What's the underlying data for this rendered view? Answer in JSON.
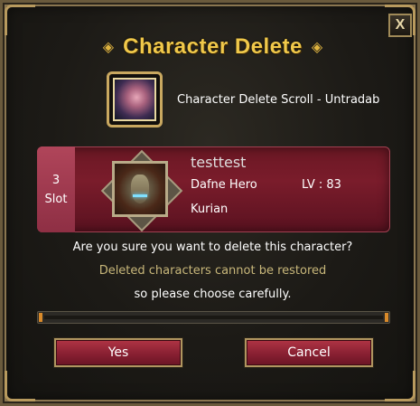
{
  "dialog": {
    "title": "Character Delete",
    "title_ornament_left": "◈",
    "title_ornament_right": "◈",
    "close_label": "X"
  },
  "item": {
    "icon": "character-delete-scroll-icon",
    "name": "Character Delete Scroll - Untradab"
  },
  "character": {
    "slot_number": "3",
    "slot_label": "Slot",
    "portrait": "armored-helmet-portrait",
    "name": "testtest",
    "class": "Dafne Hero",
    "level": "LV : 83",
    "race": "Kurian"
  },
  "messages": {
    "question": "Are you sure you want to delete this character?",
    "warning": "Deleted characters cannot be restored",
    "careful": "so please choose carefully."
  },
  "progress": {
    "fraction": 0
  },
  "buttons": {
    "yes_label": "Yes",
    "cancel_label": "Cancel"
  },
  "colors": {
    "title": "#f0c84a",
    "panel_red": "#7a1c2b",
    "warning_text": "#c8b77a",
    "progress_accent": "#d98a2a"
  }
}
